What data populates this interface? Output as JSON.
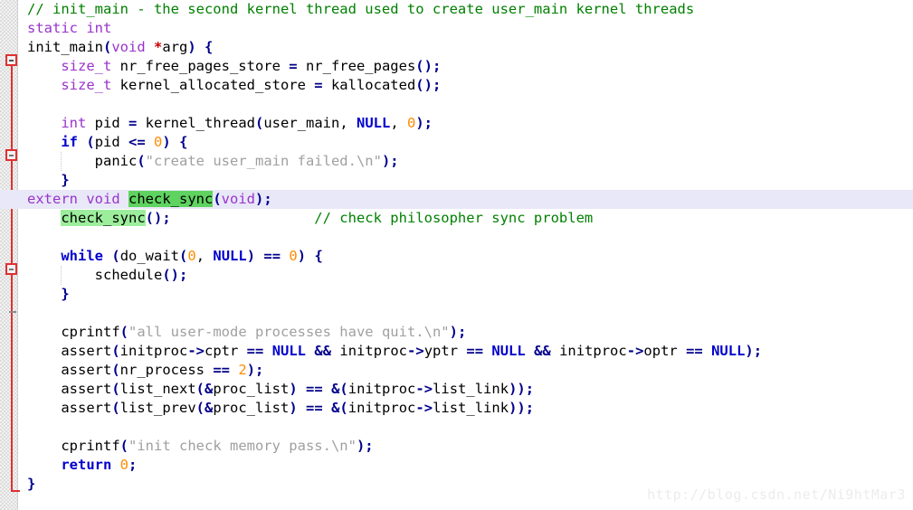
{
  "editor": {
    "language": "C",
    "background_color": "#ffffff",
    "current_line_highlight_color": "#e8e8f8",
    "selection_highlight_color": "#5fd35f",
    "occurrence_highlight_color": "#9cee9c",
    "fold_spine_color": "#e03030",
    "gutter_color": "#f2f2f2"
  },
  "watermark": {
    "text": "http://blog.csdn.net/Ni9htMar3"
  },
  "gutter": {
    "fold_markers": [
      {
        "name": "fold-function-init-main",
        "glyph": "-"
      },
      {
        "name": "fold-if-block",
        "glyph": "-"
      },
      {
        "name": "fold-while-block",
        "glyph": "-"
      }
    ],
    "fold_ticks": [
      {
        "name": "fold-end-if-block"
      },
      {
        "name": "fold-end-while-block"
      }
    ]
  },
  "code": {
    "lines": [
      {
        "n": 1,
        "text": "// init_main - the second kernel thread used to create user_main kernel threads",
        "tokens": [
          {
            "t": "// init_main - the second kernel thread used to create user_main kernel threads",
            "c": "cmt"
          }
        ]
      },
      {
        "n": 2,
        "text": "static int",
        "tokens": [
          {
            "t": "static int",
            "c": "typ"
          }
        ]
      },
      {
        "n": 3,
        "text": "init_main(void *arg) {",
        "tokens": [
          {
            "t": "init_main",
            "c": "id"
          },
          {
            "t": "(",
            "c": "pun"
          },
          {
            "t": "void",
            "c": "typ"
          },
          {
            "t": " ",
            "c": "id"
          },
          {
            "t": "*",
            "c": "star"
          },
          {
            "t": "arg",
            "c": "id"
          },
          {
            "t": ")",
            "c": "pun"
          },
          {
            "t": " ",
            "c": "id"
          },
          {
            "t": "{",
            "c": "pun"
          }
        ]
      },
      {
        "n": 4,
        "text": "    size_t nr_free_pages_store = nr_free_pages();",
        "tokens": [
          {
            "t": "    ",
            "c": "id"
          },
          {
            "t": "size_t",
            "c": "typ"
          },
          {
            "t": " nr_free_pages_store ",
            "c": "id"
          },
          {
            "t": "=",
            "c": "op"
          },
          {
            "t": " nr_free_pages",
            "c": "id"
          },
          {
            "t": "();",
            "c": "pun"
          }
        ]
      },
      {
        "n": 5,
        "text": "    size_t kernel_allocated_store = kallocated();",
        "tokens": [
          {
            "t": "    ",
            "c": "id"
          },
          {
            "t": "size_t",
            "c": "typ"
          },
          {
            "t": " kernel_allocated_store ",
            "c": "id"
          },
          {
            "t": "=",
            "c": "op"
          },
          {
            "t": " kallocated",
            "c": "id"
          },
          {
            "t": "();",
            "c": "pun"
          }
        ]
      },
      {
        "n": 6,
        "text": "",
        "tokens": []
      },
      {
        "n": 7,
        "text": "    int pid = kernel_thread(user_main, NULL, 0);",
        "tokens": [
          {
            "t": "    ",
            "c": "id"
          },
          {
            "t": "int",
            "c": "typ"
          },
          {
            "t": " pid ",
            "c": "id"
          },
          {
            "t": "=",
            "c": "op"
          },
          {
            "t": " kernel_thread",
            "c": "id"
          },
          {
            "t": "(",
            "c": "pun"
          },
          {
            "t": "user_main, ",
            "c": "id"
          },
          {
            "t": "NULL",
            "c": "kw"
          },
          {
            "t": ", ",
            "c": "id"
          },
          {
            "t": "0",
            "c": "num"
          },
          {
            "t": ");",
            "c": "pun"
          }
        ]
      },
      {
        "n": 8,
        "text": "    if (pid <= 0) {",
        "tokens": [
          {
            "t": "    ",
            "c": "id"
          },
          {
            "t": "if",
            "c": "kw"
          },
          {
            "t": " ",
            "c": "id"
          },
          {
            "t": "(",
            "c": "pun"
          },
          {
            "t": "pid ",
            "c": "id"
          },
          {
            "t": "<=",
            "c": "op"
          },
          {
            "t": " ",
            "c": "id"
          },
          {
            "t": "0",
            "c": "num"
          },
          {
            "t": ")",
            "c": "pun"
          },
          {
            "t": " ",
            "c": "id"
          },
          {
            "t": "{",
            "c": "pun"
          }
        ]
      },
      {
        "n": 9,
        "text": "        panic(\"create user_main failed.\\n\");",
        "tokens": [
          {
            "t": "        ",
            "c": "id"
          },
          {
            "t": "panic",
            "c": "id"
          },
          {
            "t": "(",
            "c": "pun"
          },
          {
            "t": "\"create user_main failed.\\n\"",
            "c": "str"
          },
          {
            "t": ");",
            "c": "pun"
          }
        ]
      },
      {
        "n": 10,
        "text": "    }",
        "tokens": [
          {
            "t": "    ",
            "c": "id"
          },
          {
            "t": "}",
            "c": "pun"
          }
        ]
      },
      {
        "n": 11,
        "current_line": true,
        "text": "extern void check_sync(void);",
        "tokens": [
          {
            "t": "extern void",
            "c": "typ"
          },
          {
            "t": " ",
            "c": "id"
          },
          {
            "t": "check_sync",
            "c": "id",
            "hl": "hl-sel"
          },
          {
            "t": "(",
            "c": "pun"
          },
          {
            "t": "void",
            "c": "typ"
          },
          {
            "t": ");",
            "c": "pun"
          }
        ]
      },
      {
        "n": 12,
        "text": "    check_sync();                   // check philosopher sync problem",
        "tokens": [
          {
            "t": "    ",
            "c": "id"
          },
          {
            "t": "check_sync",
            "c": "id",
            "hl": "hl-occ"
          },
          {
            "t": "();",
            "c": "pun"
          },
          {
            "t": "                 ",
            "c": "id"
          },
          {
            "t": "// check philosopher sync problem",
            "c": "cmt"
          }
        ]
      },
      {
        "n": 13,
        "text": "",
        "tokens": []
      },
      {
        "n": 14,
        "text": "    while (do_wait(0, NULL) == 0) {",
        "tokens": [
          {
            "t": "    ",
            "c": "id"
          },
          {
            "t": "while",
            "c": "kw"
          },
          {
            "t": " ",
            "c": "id"
          },
          {
            "t": "(",
            "c": "pun"
          },
          {
            "t": "do_wait",
            "c": "id"
          },
          {
            "t": "(",
            "c": "pun"
          },
          {
            "t": "0",
            "c": "num"
          },
          {
            "t": ", ",
            "c": "id"
          },
          {
            "t": "NULL",
            "c": "kw"
          },
          {
            "t": ")",
            "c": "pun"
          },
          {
            "t": " ",
            "c": "id"
          },
          {
            "t": "==",
            "c": "op"
          },
          {
            "t": " ",
            "c": "id"
          },
          {
            "t": "0",
            "c": "num"
          },
          {
            "t": ")",
            "c": "pun"
          },
          {
            "t": " ",
            "c": "id"
          },
          {
            "t": "{",
            "c": "pun"
          }
        ]
      },
      {
        "n": 15,
        "text": "        schedule();",
        "tokens": [
          {
            "t": "        ",
            "c": "id"
          },
          {
            "t": "schedule",
            "c": "id"
          },
          {
            "t": "();",
            "c": "pun"
          }
        ]
      },
      {
        "n": 16,
        "text": "    }",
        "tokens": [
          {
            "t": "    ",
            "c": "id"
          },
          {
            "t": "}",
            "c": "pun"
          }
        ]
      },
      {
        "n": 17,
        "text": "",
        "tokens": []
      },
      {
        "n": 18,
        "text": "    cprintf(\"all user-mode processes have quit.\\n\");",
        "tokens": [
          {
            "t": "    ",
            "c": "id"
          },
          {
            "t": "cprintf",
            "c": "id"
          },
          {
            "t": "(",
            "c": "pun"
          },
          {
            "t": "\"all user-mode processes have quit.\\n\"",
            "c": "str"
          },
          {
            "t": ");",
            "c": "pun"
          }
        ]
      },
      {
        "n": 19,
        "text": "    assert(initproc->cptr == NULL && initproc->yptr == NULL && initproc->optr == NULL);",
        "tokens": [
          {
            "t": "    ",
            "c": "id"
          },
          {
            "t": "assert",
            "c": "id"
          },
          {
            "t": "(",
            "c": "pun"
          },
          {
            "t": "initproc",
            "c": "id"
          },
          {
            "t": "->",
            "c": "op"
          },
          {
            "t": "cptr ",
            "c": "id"
          },
          {
            "t": "==",
            "c": "op"
          },
          {
            "t": " ",
            "c": "id"
          },
          {
            "t": "NULL",
            "c": "kw"
          },
          {
            "t": " ",
            "c": "id"
          },
          {
            "t": "&&",
            "c": "op"
          },
          {
            "t": " initproc",
            "c": "id"
          },
          {
            "t": "->",
            "c": "op"
          },
          {
            "t": "yptr ",
            "c": "id"
          },
          {
            "t": "==",
            "c": "op"
          },
          {
            "t": " ",
            "c": "id"
          },
          {
            "t": "NULL",
            "c": "kw"
          },
          {
            "t": " ",
            "c": "id"
          },
          {
            "t": "&&",
            "c": "op"
          },
          {
            "t": " initproc",
            "c": "id"
          },
          {
            "t": "->",
            "c": "op"
          },
          {
            "t": "optr ",
            "c": "id"
          },
          {
            "t": "==",
            "c": "op"
          },
          {
            "t": " ",
            "c": "id"
          },
          {
            "t": "NULL",
            "c": "kw"
          },
          {
            "t": ");",
            "c": "pun"
          }
        ]
      },
      {
        "n": 20,
        "text": "    assert(nr_process == 2);",
        "tokens": [
          {
            "t": "    ",
            "c": "id"
          },
          {
            "t": "assert",
            "c": "id"
          },
          {
            "t": "(",
            "c": "pun"
          },
          {
            "t": "nr_process ",
            "c": "id"
          },
          {
            "t": "==",
            "c": "op"
          },
          {
            "t": " ",
            "c": "id"
          },
          {
            "t": "2",
            "c": "num"
          },
          {
            "t": ");",
            "c": "pun"
          }
        ]
      },
      {
        "n": 21,
        "text": "    assert(list_next(&proc_list) == &(initproc->list_link));",
        "tokens": [
          {
            "t": "    ",
            "c": "id"
          },
          {
            "t": "assert",
            "c": "id"
          },
          {
            "t": "(",
            "c": "pun"
          },
          {
            "t": "list_next",
            "c": "id"
          },
          {
            "t": "(",
            "c": "pun"
          },
          {
            "t": "&",
            "c": "op"
          },
          {
            "t": "proc_list",
            "c": "id"
          },
          {
            "t": ")",
            "c": "pun"
          },
          {
            "t": " ",
            "c": "id"
          },
          {
            "t": "==",
            "c": "op"
          },
          {
            "t": " ",
            "c": "id"
          },
          {
            "t": "&(",
            "c": "op"
          },
          {
            "t": "initproc",
            "c": "id"
          },
          {
            "t": "->",
            "c": "op"
          },
          {
            "t": "list_link",
            "c": "id"
          },
          {
            "t": "));",
            "c": "pun"
          }
        ]
      },
      {
        "n": 22,
        "text": "    assert(list_prev(&proc_list) == &(initproc->list_link));",
        "tokens": [
          {
            "t": "    ",
            "c": "id"
          },
          {
            "t": "assert",
            "c": "id"
          },
          {
            "t": "(",
            "c": "pun"
          },
          {
            "t": "list_prev",
            "c": "id"
          },
          {
            "t": "(",
            "c": "pun"
          },
          {
            "t": "&",
            "c": "op"
          },
          {
            "t": "proc_list",
            "c": "id"
          },
          {
            "t": ")",
            "c": "pun"
          },
          {
            "t": " ",
            "c": "id"
          },
          {
            "t": "==",
            "c": "op"
          },
          {
            "t": " ",
            "c": "id"
          },
          {
            "t": "&(",
            "c": "op"
          },
          {
            "t": "initproc",
            "c": "id"
          },
          {
            "t": "->",
            "c": "op"
          },
          {
            "t": "list_link",
            "c": "id"
          },
          {
            "t": "));",
            "c": "pun"
          }
        ]
      },
      {
        "n": 23,
        "text": "",
        "tokens": []
      },
      {
        "n": 24,
        "text": "    cprintf(\"init check memory pass.\\n\");",
        "tokens": [
          {
            "t": "    ",
            "c": "id"
          },
          {
            "t": "cprintf",
            "c": "id"
          },
          {
            "t": "(",
            "c": "pun"
          },
          {
            "t": "\"init check memory pass.\\n\"",
            "c": "str"
          },
          {
            "t": ");",
            "c": "pun"
          }
        ]
      },
      {
        "n": 25,
        "text": "    return 0;",
        "tokens": [
          {
            "t": "    ",
            "c": "id"
          },
          {
            "t": "return",
            "c": "kw"
          },
          {
            "t": " ",
            "c": "id"
          },
          {
            "t": "0",
            "c": "num"
          },
          {
            "t": ";",
            "c": "pun"
          }
        ]
      },
      {
        "n": 26,
        "text": "}",
        "tokens": [
          {
            "t": "}",
            "c": "pun"
          }
        ]
      }
    ]
  }
}
